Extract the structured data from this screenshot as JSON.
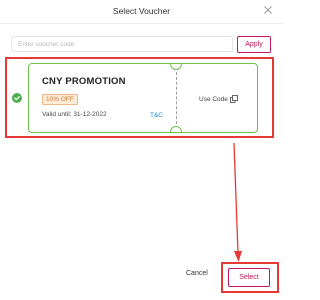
{
  "header": {
    "title": "Select Voucher",
    "close_icon": "close-icon"
  },
  "voucher_input": {
    "placeholder": "Enter voucher code",
    "value": "",
    "apply_label": "Apply"
  },
  "vouchers": [
    {
      "selected": true,
      "name": "CNY PROMOTION",
      "discount_badge": "10% OFF",
      "valid_until": "Valid until: 31-12-2022",
      "tnc_label": "T&C",
      "use_code_label": "Use Code",
      "copy_icon": "copy-icon"
    }
  ],
  "footer": {
    "cancel_label": "Cancel",
    "select_label": "Select"
  },
  "colors": {
    "accent": "#c2185b",
    "ticket_border": "#6cc24a",
    "check_green": "#4caf50",
    "badge_text": "#d4772c",
    "badge_bg": "#fdebd6",
    "link_blue": "#1e88e5",
    "annotation_red": "#e53935"
  }
}
